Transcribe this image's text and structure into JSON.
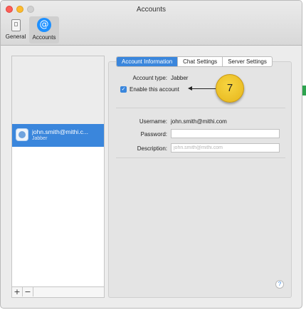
{
  "window": {
    "title": "Accounts"
  },
  "toolbar": {
    "items": [
      {
        "label": "General",
        "icon": "general-icon"
      },
      {
        "label": "Accounts",
        "icon": "at-sign-icon",
        "glyph": "@"
      }
    ]
  },
  "sidebar": {
    "accounts": [
      {
        "name": "john.smith@mithi.c...",
        "type": "Jabber"
      }
    ],
    "add_label": "+",
    "remove_label": "−"
  },
  "tabs": [
    {
      "label": "Account Information",
      "active": true
    },
    {
      "label": "Chat Settings",
      "active": false
    },
    {
      "label": "Server Settings",
      "active": false
    }
  ],
  "account_info": {
    "account_type_label": "Account type:",
    "account_type_value": "Jabber",
    "enable_label": "Enable this account",
    "enable_checked": true,
    "username_label": "Username:",
    "username_value": "john.smith@mithi.com",
    "password_label": "Password:",
    "password_value": "",
    "description_label": "Description:",
    "description_placeholder": "john.smith@mithi.com"
  },
  "help_label": "?",
  "callout": {
    "number": "7"
  },
  "colors": {
    "accent": "#3a86dc",
    "callout": "#f2c82f"
  }
}
